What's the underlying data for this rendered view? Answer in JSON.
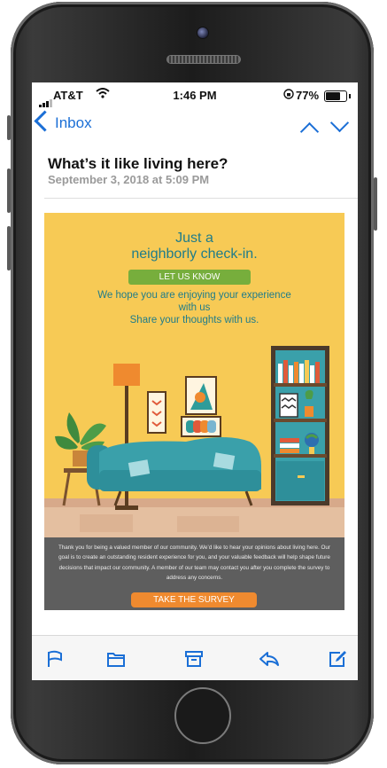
{
  "status_bar": {
    "carrier": "AT&T",
    "time": "1:46 PM",
    "battery": "77%"
  },
  "nav": {
    "back_label": "Inbox"
  },
  "email": {
    "subject": "What’s it like living here?",
    "date": "September 3, 2018 at 5:09 PM",
    "headline_line1": "Just a",
    "headline_line2": "neighborly check-in.",
    "cta_label": "LET US KNOW",
    "intro_line1": "We hope you are enjoying your experience",
    "intro_line2": "with us",
    "intro_line3": "Share your thoughts with us.",
    "body_text": "Thank you for being a valued member of our community. We’d like to hear your opinions about living here. Our goal is to create an outstanding resident experience for you, and your valuable feedback will help shape future decisions that impact our community. A member of our team may contact you after you complete the survey to address any concerns.",
    "survey_label": "TAKE THE SURVEY"
  },
  "colors": {
    "accent_blue": "#1b6fd6",
    "email_background": "#f7ca55",
    "teal_text": "#1f7c8a",
    "cta_green": "#77ae3c",
    "survey_orange": "#ef8a2f",
    "footer_gray": "#5e5e5e"
  },
  "toolbar": {
    "icons": [
      "flag-icon",
      "folder-icon",
      "archive-icon",
      "reply-icon",
      "compose-icon"
    ]
  }
}
